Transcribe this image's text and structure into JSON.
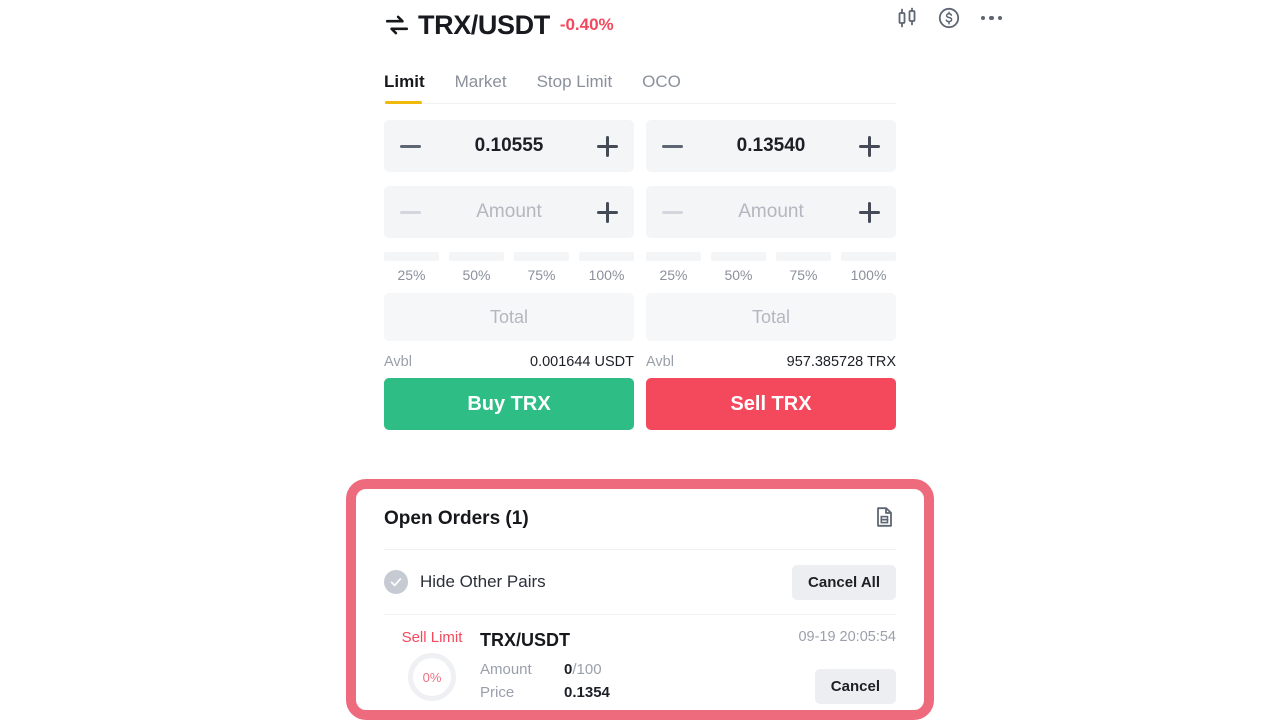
{
  "header": {
    "swap_icon": "swap-arrows-icon",
    "pair": "TRX/USDT",
    "change": "-0.40%",
    "change_color": "#f4485d",
    "icons": [
      "candlestick-chart-icon",
      "dollar-circle-icon",
      "more-options-icon"
    ]
  },
  "tabs": [
    {
      "label": "Limit",
      "active": true
    },
    {
      "label": "Market",
      "active": false
    },
    {
      "label": "Stop Limit",
      "active": false
    },
    {
      "label": "OCO",
      "active": false
    }
  ],
  "buy": {
    "price_value": "0.10555",
    "amount_placeholder": "Amount",
    "percents": [
      "25%",
      "50%",
      "75%",
      "100%"
    ],
    "total_placeholder": "Total",
    "avbl_label": "Avbl",
    "avbl_value": "0.001644 USDT",
    "cta": "Buy TRX",
    "cta_color": "#2ebd85"
  },
  "sell": {
    "price_value": "0.13540",
    "amount_placeholder": "Amount",
    "percents": [
      "25%",
      "50%",
      "75%",
      "100%"
    ],
    "total_placeholder": "Total",
    "avbl_label": "Avbl",
    "avbl_value": "957.385728 TRX",
    "cta": "Sell TRX",
    "cta_color": "#f4485d"
  },
  "open_orders": {
    "title": "Open Orders (1)",
    "history_icon": "order-history-document-icon",
    "hide_other_pairs_label": "Hide Other Pairs",
    "hide_other_pairs_checked": true,
    "cancel_all_label": "Cancel All",
    "highlight_color": "#ee6b7d",
    "rows": [
      {
        "side": "Sell Limit",
        "progress": "0%",
        "symbol": "TRX/USDT",
        "amount_label": "Amount",
        "amount_filled": "0",
        "amount_total": "/100",
        "price_label": "Price",
        "price_value": "0.1354",
        "timestamp": "09-19 20:05:54",
        "cancel_label": "Cancel"
      }
    ]
  }
}
